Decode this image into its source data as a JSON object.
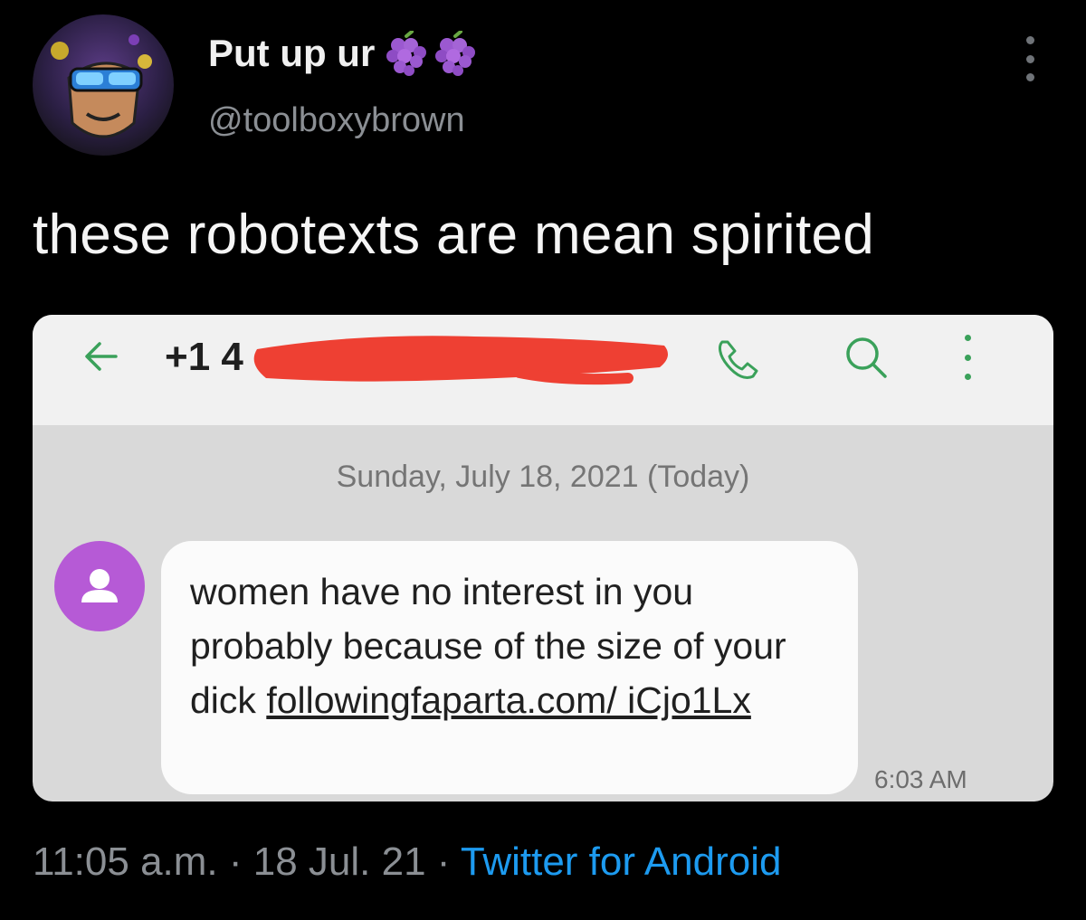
{
  "tweet": {
    "display_name": "Put up ur",
    "handle": "@toolboxybrown",
    "text": "these robotexts are mean spirited",
    "timestamp": "11:05 a.m.",
    "separator": " · ",
    "date": "18 Jul. 21",
    "source": "Twitter for Android",
    "icons": [
      "grapes-emoji",
      "grapes-emoji",
      "more-vertical-icon"
    ]
  },
  "sms_screenshot": {
    "phone_number_visible": "+1 4",
    "date_header": "Sunday, July 18, 2021 (Today)",
    "message": {
      "text_before_link": "women have no interest in you probably because of the size of your dick ",
      "link": "followingfaparta.com/ iCjo1Lx",
      "time": "6:03 AM"
    },
    "icons": [
      "back-arrow-icon",
      "phone-call-icon",
      "search-icon",
      "more-vertical-icon",
      "contact-avatar-icon"
    ],
    "colors": {
      "accent_green": "#3aa15a",
      "redaction_red": "#ee4033",
      "contact_purple": "#b65ad6"
    }
  }
}
